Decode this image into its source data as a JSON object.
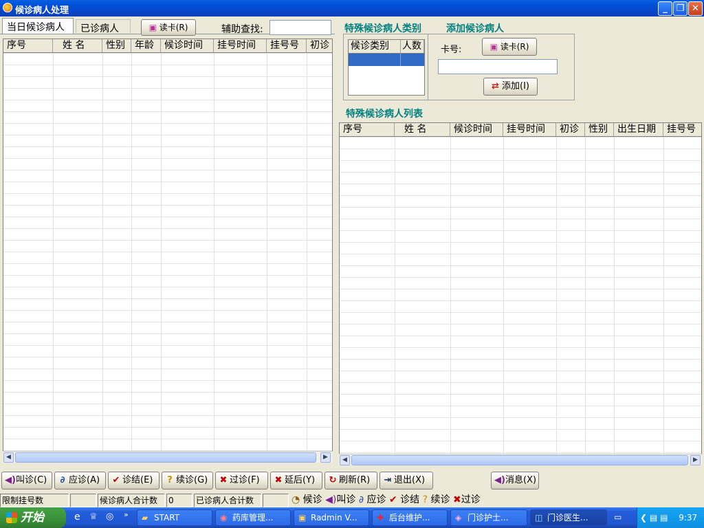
{
  "window": {
    "title": "候诊病人处理"
  },
  "tabs": [
    {
      "label": "当日候诊病人"
    },
    {
      "label": "已诊病人"
    }
  ],
  "toolbar": {
    "read_card": "读卡(R)",
    "search_label": "辅助查找:",
    "search_value": ""
  },
  "left_grid": {
    "columns": [
      "序号",
      "姓 名",
      "性别",
      "年龄",
      "候诊时间",
      "挂号时间",
      "挂号号",
      "初诊"
    ]
  },
  "special_type": {
    "title": "特殊候诊病人类别",
    "columns": [
      "候诊类别",
      "人数"
    ]
  },
  "add_patient": {
    "title": "添加候诊病人",
    "card_label": "卡号:",
    "read_card": "读卡(R)",
    "card_value": "",
    "add_button": "添加(I)"
  },
  "special_list": {
    "title": "特殊候诊病人列表",
    "columns": [
      "序号",
      "姓  名",
      "候诊时间",
      "挂号时间",
      "初诊",
      "性别",
      "出生日期",
      "挂号号"
    ]
  },
  "buttons": {
    "call": "叫诊(C)",
    "answer": "应诊(A)",
    "finish": "诊结(E)",
    "continue": "续诊(G)",
    "pass": "过诊(F)",
    "delay": "延后(Y)",
    "refresh": "刷新(R)",
    "exit": "退出(X)",
    "message": "消息(X)"
  },
  "statusbar": {
    "limit_label": "限制挂号数",
    "limit_value": "",
    "waiting_label": "候诊病人合计数",
    "waiting_value": "0",
    "done_label": "已诊病人合计数",
    "done_value": "",
    "legend": [
      "候诊",
      "叫诊",
      "应诊",
      "诊结",
      "续诊",
      "过诊"
    ]
  },
  "taskbar": {
    "start": "开始",
    "items": [
      "START",
      "药库管理...",
      "Radmin V...",
      "后台维护...",
      "门诊护士...",
      "门诊医生..."
    ],
    "clock": "9:37"
  }
}
